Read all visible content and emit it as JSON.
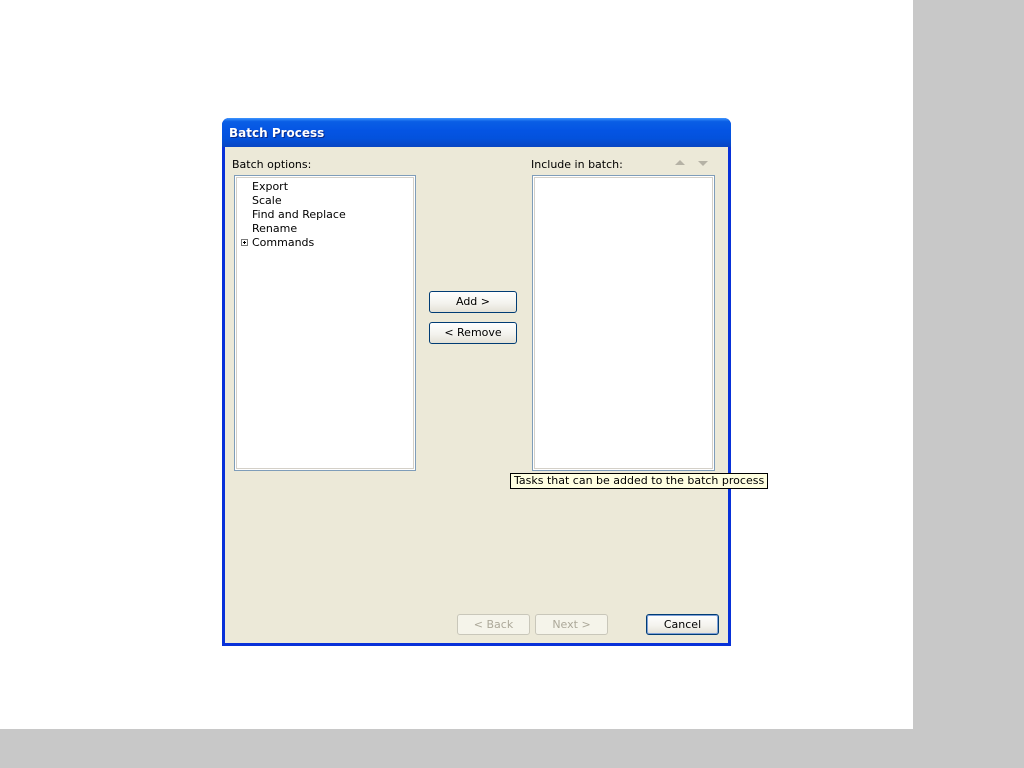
{
  "dialog": {
    "title": "Batch Process",
    "batch_options_label": "Batch options:",
    "include_label": "Include in batch:",
    "options": [
      {
        "label": "Export"
      },
      {
        "label": "Scale"
      },
      {
        "label": "Find and Replace"
      },
      {
        "label": "Rename"
      },
      {
        "label": "Commands",
        "expandable": true
      }
    ],
    "buttons": {
      "add": "Add >",
      "remove": "< Remove",
      "back": "< Back",
      "next": "Next >",
      "cancel": "Cancel"
    }
  },
  "tooltip": {
    "text": "Tasks that can be added to the batch process"
  },
  "icons": {
    "move_up": "triangle-up",
    "move_down": "triangle-down",
    "expand": "plus-box"
  },
  "colors": {
    "title_bar": "#0454e3",
    "dialog_bg": "#ece9d8",
    "frame_border": "#0831d9",
    "tooltip_bg": "#ffffe1"
  }
}
